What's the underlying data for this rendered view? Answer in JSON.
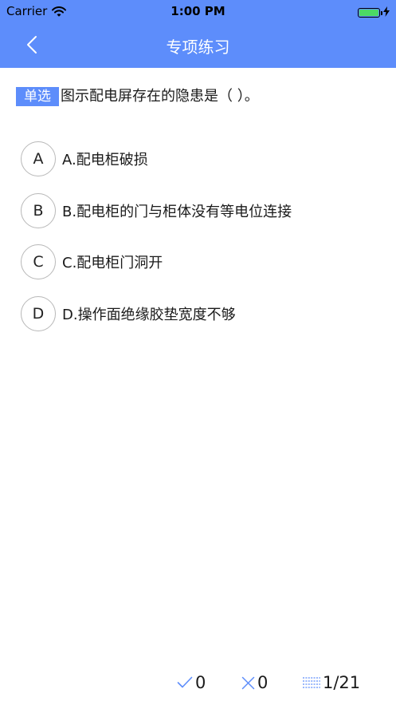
{
  "status_bar": {
    "carrier": "Carrier",
    "time": "1:00 PM",
    "battery_level": 1.0
  },
  "nav": {
    "title": "专项练习",
    "back_icon": "chevron-left-icon"
  },
  "question": {
    "type_label": "单选",
    "text": "图示配电屏存在的隐患是（    ）。"
  },
  "options": [
    {
      "letter": "A",
      "text": "A.配电柜破损"
    },
    {
      "letter": "B",
      "text": "B.配电柜的门与柜体没有等电位连接"
    },
    {
      "letter": "C",
      "text": " C.配电柜门洞开"
    },
    {
      "letter": "D",
      "text": "D.操作面绝缘胶垫宽度不够"
    }
  ],
  "bottom": {
    "correct_count": "0",
    "wrong_count": "0",
    "progress": "1/21"
  },
  "colors": {
    "accent": "#5d8dfb",
    "battery": "#4cd964"
  }
}
